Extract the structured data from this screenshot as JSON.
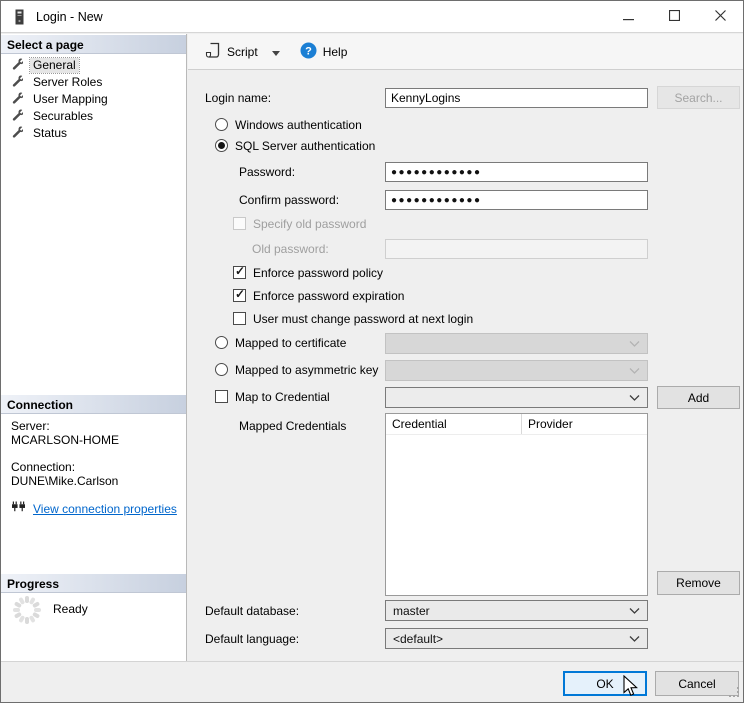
{
  "window": {
    "title": "Login - New"
  },
  "sidebar": {
    "select_header": "Select a page",
    "pages": [
      {
        "label": "General",
        "selected": true
      },
      {
        "label": "Server Roles",
        "selected": false
      },
      {
        "label": "User Mapping",
        "selected": false
      },
      {
        "label": "Securables",
        "selected": false
      },
      {
        "label": "Status",
        "selected": false
      }
    ],
    "connection": {
      "header": "Connection",
      "server_label": "Server:",
      "server_value": "MCARLSON-HOME",
      "connection_label": "Connection:",
      "connection_value": "DUNE\\Mike.Carlson",
      "view_link": "View connection properties"
    },
    "progress": {
      "header": "Progress",
      "status": "Ready"
    }
  },
  "toolbar": {
    "script": "Script",
    "help": "Help"
  },
  "form": {
    "login_name": {
      "label": "Login name:",
      "value": "KennyLogins"
    },
    "search_button": "Search...",
    "auth": {
      "windows": "Windows authentication",
      "sql": "SQL Server authentication"
    },
    "password": {
      "label": "Password:",
      "value": "●●●●●●●●●●●●"
    },
    "confirm_password": {
      "label": "Confirm password:",
      "value": "●●●●●●●●●●●●"
    },
    "specify_old_password": "Specify old password",
    "old_password": {
      "label": "Old password:",
      "value": ""
    },
    "enforce_policy": "Enforce password policy",
    "enforce_expiration": "Enforce password expiration",
    "must_change": "User must change password at next login",
    "mapped_certificate": "Mapped to certificate",
    "mapped_asymmetric_key": "Mapped to asymmetric key",
    "map_to_credential": "Map to Credential",
    "add_button": "Add",
    "mapped_credentials_label": "Mapped Credentials",
    "credentials_table": {
      "columns": [
        "Credential",
        "Provider"
      ],
      "rows": []
    },
    "remove_button": "Remove",
    "default_database": {
      "label": "Default database:",
      "value": "master"
    },
    "default_language": {
      "label": "Default language:",
      "value": "<default>"
    }
  },
  "footer": {
    "ok": "OK",
    "cancel": "Cancel"
  },
  "colors": {
    "header_gradient_start": "#eff2f8",
    "header_gradient_end": "#c7d0df",
    "link": "#0066cc",
    "ok_border": "#0078d7",
    "ok_fill": "#e5f1fb"
  }
}
